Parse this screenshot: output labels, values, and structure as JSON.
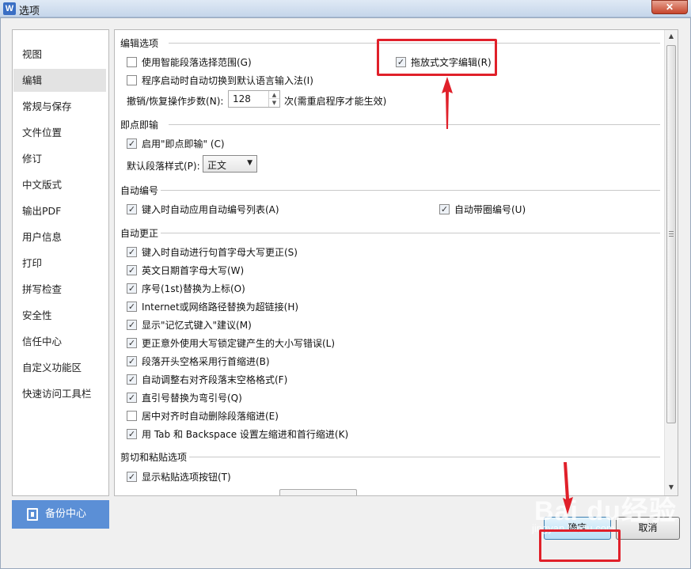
{
  "window": {
    "title": "选项",
    "app_icon": "W",
    "close_label": "✕"
  },
  "sidebar": {
    "items": [
      {
        "label": "视图"
      },
      {
        "label": "编辑",
        "active": true
      },
      {
        "label": "常规与保存"
      },
      {
        "label": "文件位置"
      },
      {
        "label": "修订"
      },
      {
        "label": "中文版式"
      },
      {
        "label": "输出PDF"
      },
      {
        "label": "用户信息"
      },
      {
        "label": "打印"
      },
      {
        "label": "拼写检查"
      },
      {
        "label": "安全性"
      },
      {
        "label": "信任中心"
      },
      {
        "label": "自定义功能区"
      },
      {
        "label": "快速访问工具栏"
      }
    ],
    "backup_label": "备份中心"
  },
  "sections": {
    "edit": {
      "title": "编辑选项",
      "smart_paragraph": {
        "label": "使用智能段落选择范围(G)",
        "checked": false
      },
      "drag_drop": {
        "label": "拖放式文字编辑(R)",
        "checked": true
      },
      "auto_switch_ime": {
        "label": "程序启动时自动切换到默认语言输入法(I)",
        "checked": false
      },
      "undo_label": "撤销/恢复操作步数(N):",
      "undo_value": "128",
      "undo_note": "次(需重启程序才能生效)"
    },
    "click_type": {
      "title": "即点即输",
      "enable": {
        "label": "启用\"即点即输\" (C)",
        "checked": true
      },
      "default_style_label": "默认段落样式(P):",
      "default_style_value": "正文"
    },
    "auto_number": {
      "title": "自动编号",
      "auto_list": {
        "label": "键入时自动应用自动编号列表(A)",
        "checked": true
      },
      "circled_number": {
        "label": "自动带圈编号(U)",
        "checked": true
      }
    },
    "auto_correct": {
      "title": "自动更正",
      "items": [
        {
          "label": "键入时自动进行句首字母大写更正(S)",
          "checked": true
        },
        {
          "label": "英文日期首字母大写(W)",
          "checked": true
        },
        {
          "label": "序号(1st)替换为上标(O)",
          "checked": true
        },
        {
          "label": "Internet或网络路径替换为超链接(H)",
          "checked": true
        },
        {
          "label": "显示\"记忆式键入\"建议(M)",
          "checked": true
        },
        {
          "label": "更正意外使用大写锁定键产生的大小写错误(L)",
          "checked": true
        },
        {
          "label": "段落开头空格采用行首缩进(B)",
          "checked": true
        },
        {
          "label": "自动调整右对齐段落末空格格式(F)",
          "checked": true
        },
        {
          "label": "直引号替换为弯引号(Q)",
          "checked": true
        },
        {
          "label": "居中对齐时自动删除段落缩进(E)",
          "checked": false
        },
        {
          "label": "用 Tab 和 Backspace 设置左缩进和首行缩进(K)",
          "checked": true
        }
      ]
    },
    "cut_paste": {
      "title": "剪切和粘贴选项",
      "show_paste_btn": {
        "label": "显示粘贴选项按钮(T)",
        "checked": true
      }
    }
  },
  "buttons": {
    "ok_label": "确定",
    "cancel_label": "取消"
  },
  "watermark": {
    "brand": "Bai du经验",
    "url": "jingyan.baidu.com"
  },
  "colors": {
    "accent": "#5b8fd6",
    "annotation_red": "#e0202a"
  }
}
